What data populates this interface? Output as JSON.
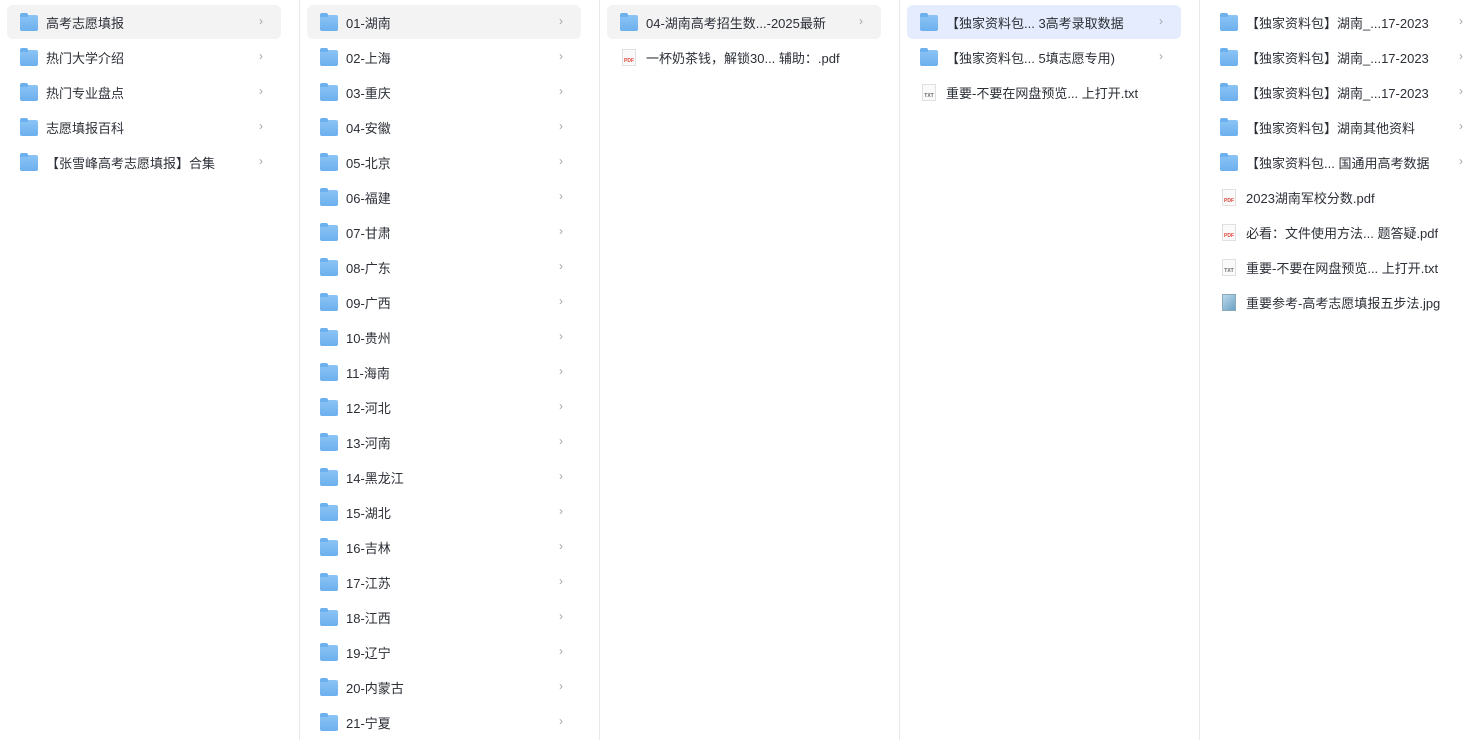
{
  "columns": [
    {
      "selected": 0,
      "items": [
        {
          "label": "高考志愿填报",
          "type": "folder"
        },
        {
          "label": "热门大学介绍",
          "type": "folder"
        },
        {
          "label": "热门专业盘点",
          "type": "folder"
        },
        {
          "label": "志愿填报百科",
          "type": "folder"
        },
        {
          "label": "【张雪峰高考志愿填报】合集",
          "type": "folder"
        }
      ]
    },
    {
      "selected": 0,
      "items": [
        {
          "label": "01-湖南",
          "type": "folder"
        },
        {
          "label": "02-上海",
          "type": "folder"
        },
        {
          "label": "03-重庆",
          "type": "folder"
        },
        {
          "label": "04-安徽",
          "type": "folder"
        },
        {
          "label": "05-北京",
          "type": "folder"
        },
        {
          "label": "06-福建",
          "type": "folder"
        },
        {
          "label": "07-甘肃",
          "type": "folder"
        },
        {
          "label": "08-广东",
          "type": "folder"
        },
        {
          "label": "09-广西",
          "type": "folder"
        },
        {
          "label": "10-贵州",
          "type": "folder"
        },
        {
          "label": "11-海南",
          "type": "folder"
        },
        {
          "label": "12-河北",
          "type": "folder"
        },
        {
          "label": "13-河南",
          "type": "folder"
        },
        {
          "label": "14-黑龙江",
          "type": "folder"
        },
        {
          "label": "15-湖北",
          "type": "folder"
        },
        {
          "label": "16-吉林",
          "type": "folder"
        },
        {
          "label": "17-江苏",
          "type": "folder"
        },
        {
          "label": "18-江西",
          "type": "folder"
        },
        {
          "label": "19-辽宁",
          "type": "folder"
        },
        {
          "label": "20-内蒙古",
          "type": "folder"
        },
        {
          "label": "21-宁夏",
          "type": "folder"
        }
      ]
    },
    {
      "selected": 0,
      "items": [
        {
          "label": "04-湖南高考招生数...-2025最新",
          "type": "folder"
        },
        {
          "label": "一杯奶茶钱，解锁30...  辅助：.pdf",
          "type": "pdf",
          "badge": "PDF"
        }
      ]
    },
    {
      "selected": 0,
      "active": true,
      "items": [
        {
          "label": "【独家资料包...  3高考录取数据",
          "type": "folder"
        },
        {
          "label": "【独家资料包...  5填志愿专用)",
          "type": "folder"
        },
        {
          "label": "重要-不要在网盘预览...  上打开.txt",
          "type": "txt",
          "badge": "TXT"
        }
      ]
    },
    {
      "selected": -1,
      "items": [
        {
          "label": "【独家资料包】湖南_...17-2023",
          "type": "folder"
        },
        {
          "label": "【独家资料包】湖南_...17-2023",
          "type": "folder"
        },
        {
          "label": "【独家资料包】湖南_...17-2023",
          "type": "folder"
        },
        {
          "label": "【独家资料包】湖南其他资料",
          "type": "folder"
        },
        {
          "label": "【独家资料包... 国通用高考数据",
          "type": "folder"
        },
        {
          "label": "2023湖南军校分数.pdf",
          "type": "pdf",
          "badge": "PDF"
        },
        {
          "label": "必看：文件使用方法...  题答疑.pdf",
          "type": "pdf",
          "badge": "PDF"
        },
        {
          "label": "重要-不要在网盘预览...  上打开.txt",
          "type": "txt",
          "badge": "TXT"
        },
        {
          "label": "重要参考-高考志愿填报五步法.jpg",
          "type": "jpg"
        }
      ]
    }
  ],
  "chevron": "›"
}
